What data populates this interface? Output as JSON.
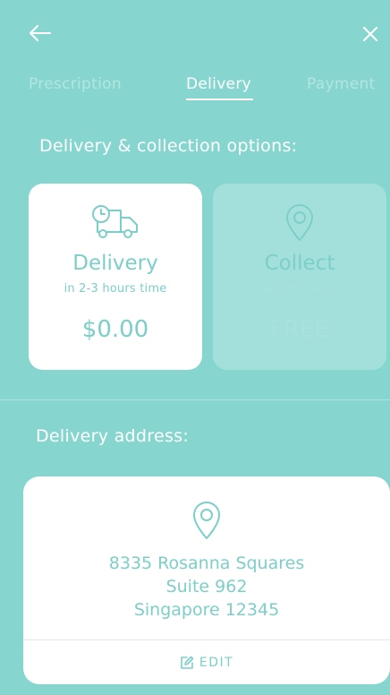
{
  "nav": {
    "back_icon": "arrow-left-icon",
    "close_icon": "close-icon"
  },
  "tabs": [
    {
      "label": "Prescription",
      "active": false
    },
    {
      "label": "Delivery",
      "active": true
    },
    {
      "label": "Payment",
      "active": false
    }
  ],
  "options": {
    "title": "Delivery & collection options:",
    "delivery": {
      "title": "Delivery",
      "subtitle": "in 2-3 hours time",
      "price": "$0.00",
      "icon": "delivery-truck-icon",
      "selected": true
    },
    "collect": {
      "title": "Collect",
      "subtitle": "at the clinic",
      "price": "FREE",
      "icon": "location-pin-icon",
      "selected": false
    }
  },
  "address": {
    "title": "Delivery address:",
    "line1": "8335 Rosanna Squares",
    "line2": "Suite 962",
    "line3": "Singapore 12345",
    "edit_label": "EDIT",
    "icon": "location-pin-icon"
  },
  "colors": {
    "background": "#86d6cf",
    "accent": "#7ccfc8",
    "white": "#ffffff"
  }
}
